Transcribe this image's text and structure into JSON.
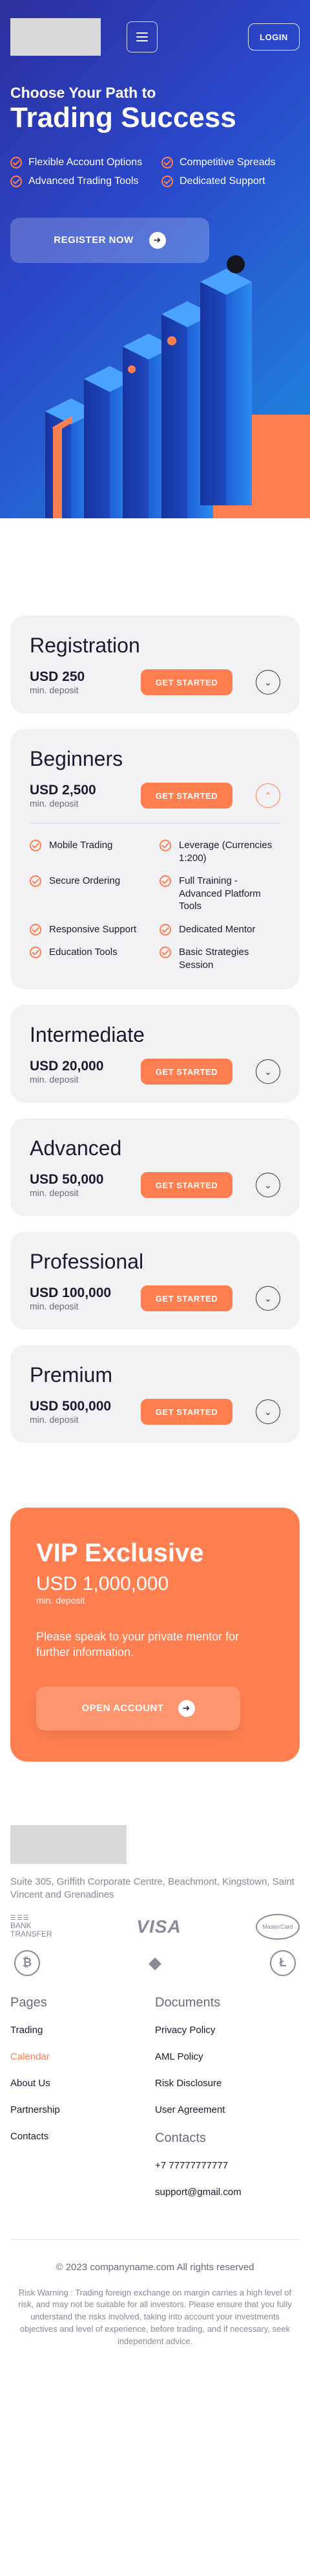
{
  "header": {
    "login_label": "LOGIN"
  },
  "hero": {
    "subtitle": "Choose Your Path to",
    "title": "Trading Success",
    "features": [
      "Flexible Account Options",
      "Competitive Spreads",
      "Advanced Trading Tools",
      "Dedicated Support"
    ],
    "register_label": "REGISTER NOW",
    "colors": {
      "accent": "#ff7f50",
      "hero_start": "#2d2f9e",
      "hero_end": "#1d8be0"
    }
  },
  "plans": [
    {
      "title": "Registration",
      "amount": "USD 250",
      "min_label": "min. deposit",
      "button": "GET STARTED",
      "expanded": false
    },
    {
      "title": "Beginners",
      "amount": "USD 2,500",
      "min_label": "min. deposit",
      "button": "GET STARTED",
      "expanded": true,
      "features": [
        "Mobile Trading",
        "Leverage (Currencies 1:200)",
        "Secure Ordering",
        "Full Training - Advanced Platform Tools",
        "Responsive Support",
        "Dedicated Mentor",
        "Education Tools",
        "Basic Strategies Session"
      ]
    },
    {
      "title": "Intermediate",
      "amount": "USD 20,000",
      "min_label": "min. deposit",
      "button": "GET STARTED",
      "expanded": false
    },
    {
      "title": "Advanced",
      "amount": "USD 50,000",
      "min_label": "min. deposit",
      "button": "GET STARTED",
      "expanded": false
    },
    {
      "title": "Professional",
      "amount": "USD 100,000",
      "min_label": "min. deposit",
      "button": "GET STARTED",
      "expanded": false
    },
    {
      "title": "Premium",
      "amount": "USD 500,000",
      "min_label": "min. deposit",
      "button": "GET STARTED",
      "expanded": false
    }
  ],
  "vip": {
    "title": "VIP Exclusive",
    "amount": "USD 1,000,000",
    "min_label": "min. deposit",
    "text": "Please speak to your private mentor for further information.",
    "button": "OPEN ACCOUNT"
  },
  "footer": {
    "address": "Suite 305, Griffith Corporate Centre, Beachmont, Kingstown, Saint Vincent and Grenadines",
    "payments": {
      "bank": "BANK TRANSFER",
      "visa": "VISA",
      "mastercard": "MasterCard"
    },
    "pages_title": "Pages",
    "pages": [
      "Trading",
      "Calendar",
      "About Us",
      "Partnership",
      "Contacts"
    ],
    "documents_title": "Documents",
    "documents": [
      "Privacy Policy",
      "AML Policy",
      "Risk Disclosure",
      "User Agreement"
    ],
    "contacts_title": "Contacts",
    "phone": "+7 77777777777",
    "email": "support@gmail.com",
    "copyright": "© 2023 companyname.com All rights reserved",
    "risk_warning": "Risk Warning : Trading foreign exchange on margin carries a high level of risk, and may not be suitable for all investors. Please ensure that you fully understand the risks involved, taking into account your investments objectives and level of experience, before trading, and if necessary, seek independent advice."
  }
}
